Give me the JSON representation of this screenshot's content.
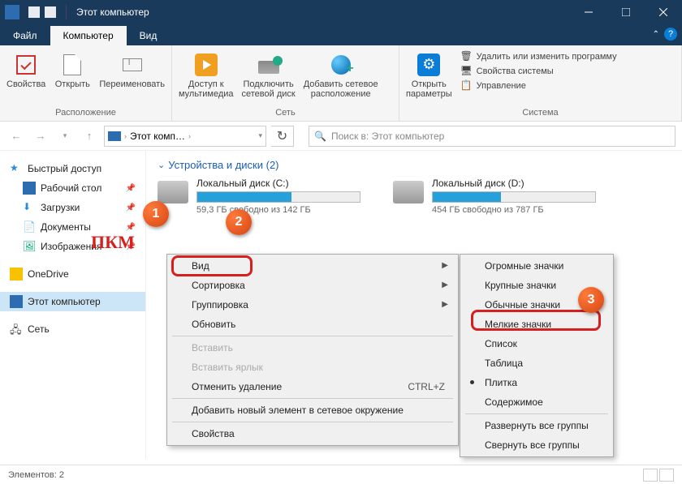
{
  "window_title": "Этот компьютер",
  "tabs": {
    "file": "Файл",
    "computer": "Компьютер",
    "view": "Вид"
  },
  "ribbon": {
    "location_group": "Расположение",
    "network_group": "Сеть",
    "system_group": "Система",
    "properties": "Свойства",
    "open": "Открыть",
    "rename": "Переименовать",
    "media_access": "Доступ к\nмультимедиа",
    "map_drive": "Подключить\nсетевой диск",
    "add_net_location": "Добавить сетевое\nрасположение",
    "open_settings": "Открыть\nпараметры",
    "uninstall": "Удалить или изменить программу",
    "sys_props": "Свойства системы",
    "management": "Управление"
  },
  "addressbar": {
    "path": "Этот комп…",
    "search_placeholder": "Поиск в: Этот компьютер"
  },
  "sidebar": {
    "quick_access": "Быстрый доступ",
    "desktop": "Рабочий стол",
    "downloads": "Загрузки",
    "documents": "Документы",
    "pictures": "Изображения",
    "onedrive": "OneDrive",
    "this_pc": "Этот компьютер",
    "network": "Сеть"
  },
  "content": {
    "section_title": "Устройства и диски (2)",
    "drives": [
      {
        "name": "Локальный диск (C:)",
        "free_text": "59,3 ГБ свободно из 142 ГБ",
        "fill_pct": 58
      },
      {
        "name": "Локальный диск (D:)",
        "free_text": "454 ГБ свободно из 787 ГБ",
        "fill_pct": 42
      }
    ]
  },
  "context_menu": {
    "view": "Вид",
    "sort": "Сортировка",
    "group": "Группировка",
    "refresh": "Обновить",
    "paste": "Вставить",
    "paste_shortcut": "Вставить ярлык",
    "undo_delete": "Отменить удаление",
    "undo_shortcut": "CTRL+Z",
    "add_net_element": "Добавить новый элемент в сетевое окружение",
    "properties": "Свойства"
  },
  "submenu": {
    "extra_large": "Огромные значки",
    "large": "Крупные значки",
    "medium": "Обычные значки",
    "small": "Мелкие значки",
    "list": "Список",
    "details": "Таблица",
    "tiles": "Плитка",
    "content": "Содержимое",
    "expand_all": "Развернуть все группы",
    "collapse_all": "Свернуть все группы"
  },
  "status": {
    "items": "Элементов: 2"
  },
  "annotations": {
    "bubble1": "1",
    "bubble2": "2",
    "bubble3": "3",
    "pkm": "ПКМ"
  }
}
